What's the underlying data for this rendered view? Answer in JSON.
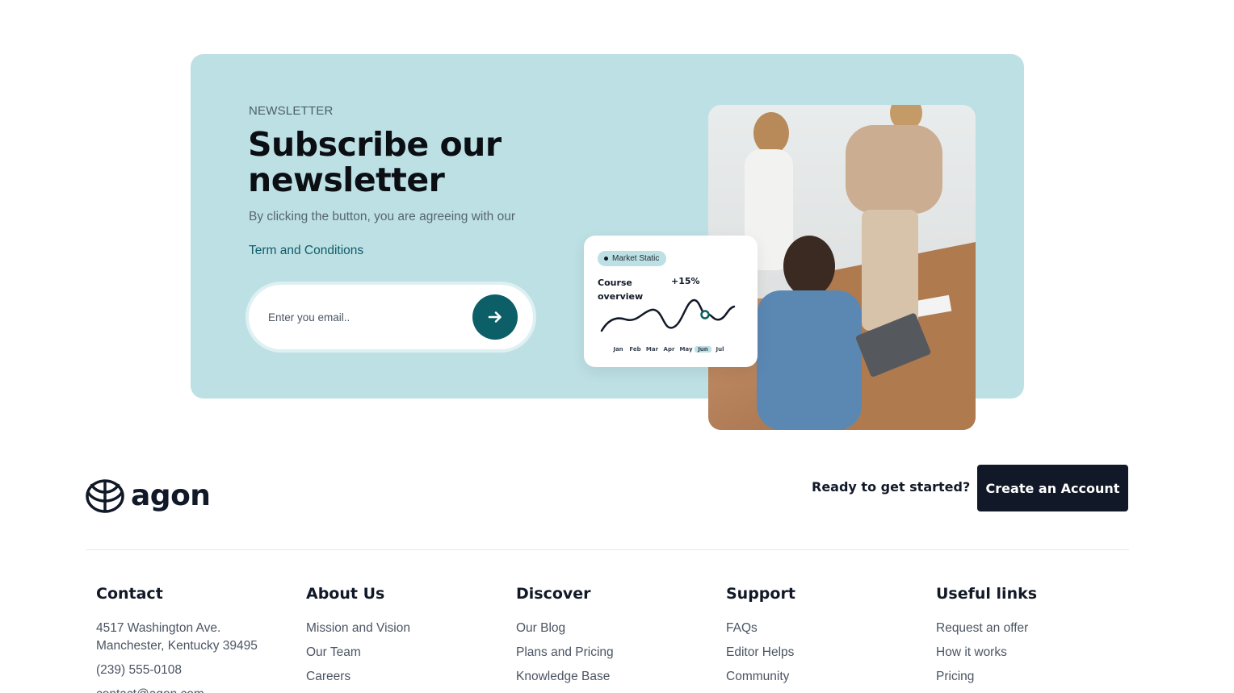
{
  "newsletter": {
    "eyebrow": "NEWSLETTER",
    "title": "Subscribe our newsletter",
    "description": "By clicking the button, you are agreeing with our",
    "terms_link": "Term and Conditions",
    "email_placeholder": "Enter you email..",
    "submit_icon": "arrow-right-icon",
    "colors": {
      "card_bg": "#bde0e4",
      "accent": "#0c5f67"
    }
  },
  "stat_card": {
    "pill_label": "Market Static",
    "title": "Course overview",
    "change": "+15%",
    "months": [
      "Jan",
      "Feb",
      "Mar",
      "Apr",
      "May",
      "Jun",
      "Jul"
    ],
    "active_month": "Jun"
  },
  "footer": {
    "logo_text": "agon",
    "logo_icon": "leaf-globe-icon",
    "cta_text": "Ready to get started?",
    "cta_button": "Create an Account",
    "columns": {
      "contact": {
        "title": "Contact",
        "address": "4517 Washington Ave. Manchester, Kentucky 39495",
        "phone": "(239) 555-0108",
        "email": "contact@agon.com"
      },
      "about": {
        "title": "About Us",
        "links": [
          "Mission and Vision",
          "Our Team",
          "Careers"
        ]
      },
      "discover": {
        "title": "Discover",
        "links": [
          "Our Blog",
          "Plans and Pricing",
          "Knowledge Base"
        ]
      },
      "support": {
        "title": "Support",
        "links": [
          "FAQs",
          "Editor Helps",
          "Community"
        ]
      },
      "useful": {
        "title": "Useful links",
        "links": [
          "Request an offer",
          "How it works",
          "Pricing"
        ]
      }
    }
  }
}
